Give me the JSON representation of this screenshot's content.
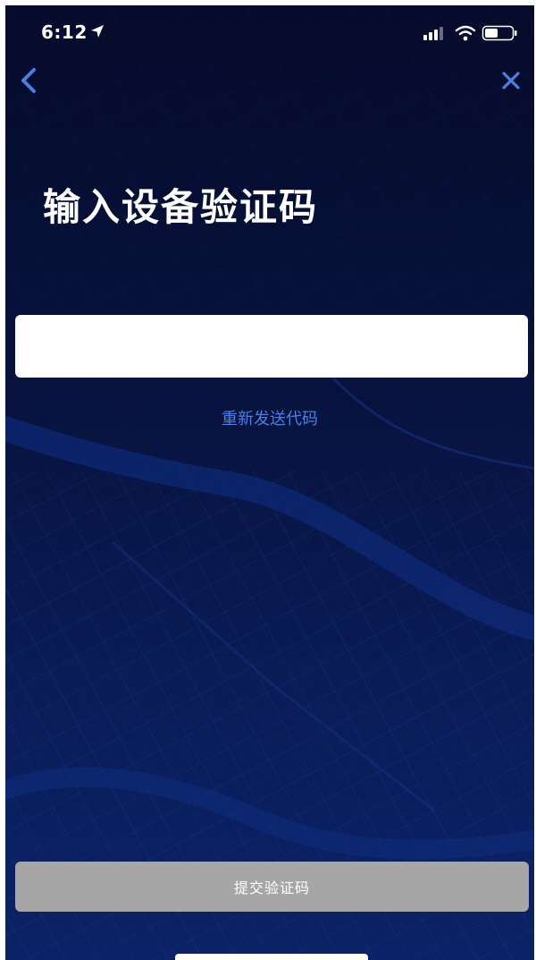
{
  "status_bar": {
    "time": "6:12",
    "icons": [
      "location-arrow-icon",
      "signal-icon",
      "wifi-icon",
      "battery-icon"
    ]
  },
  "nav": {
    "back_icon": "chevron-left-icon",
    "close_icon": "close-icon"
  },
  "title": "输入设备验证码",
  "code_input": {
    "value": "",
    "placeholder": ""
  },
  "resend_link": "重新发送代码",
  "submit_button": "提交验证码",
  "colors": {
    "background_top": "#060b2b",
    "background_bottom": "#0b2266",
    "accent": "#4b7fe0",
    "button_disabled": "#a6a6a6",
    "nav_icon": "#4b7fe0"
  }
}
